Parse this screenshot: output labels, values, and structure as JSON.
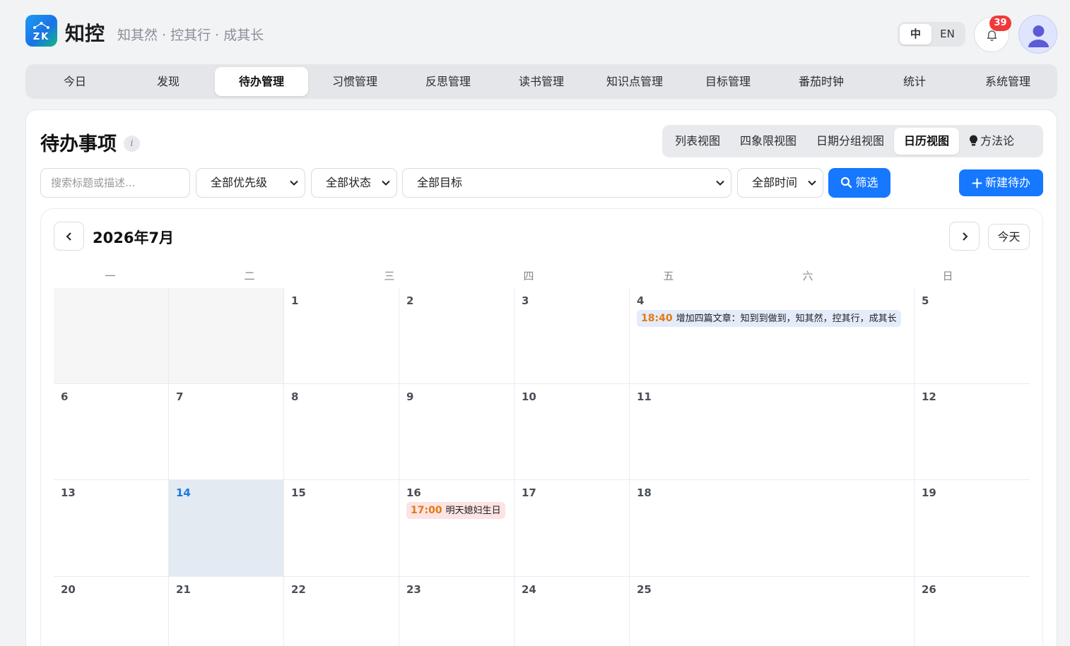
{
  "app": {
    "logo_text": "ZK",
    "name": "知控",
    "slogan": "知其然 · 控其行 · 成其长"
  },
  "lang": {
    "zh": "中",
    "en": "EN",
    "active": "zh"
  },
  "notifications": {
    "count": "39"
  },
  "nav": {
    "items": [
      "今日",
      "发现",
      "待办管理",
      "习惯管理",
      "反思管理",
      "读书管理",
      "知识点管理",
      "目标管理",
      "番茄时钟",
      "统计",
      "系统管理"
    ],
    "active": "待办管理"
  },
  "page": {
    "title": "待办事项",
    "info": "i"
  },
  "views": {
    "list": "列表视图",
    "quadrant": "四象限视图",
    "date_group": "日期分组视图",
    "calendar": "日历视图",
    "method": "方法论",
    "active": "日历视图"
  },
  "filters": {
    "search_placeholder": "搜索标题或描述...",
    "priority": "全部优先级",
    "status": "全部状态",
    "goal": "全部目标",
    "time": "全部时间",
    "filter_button": "筛选",
    "new_button": "新建待办"
  },
  "calendar": {
    "title": "2026年7月",
    "today_button": "今天",
    "weekdays": [
      "一",
      "二",
      "三",
      "四",
      "五",
      "六",
      "日"
    ],
    "weeks": [
      [
        {
          "day": "",
          "outside": true
        },
        {
          "day": "",
          "outside": true
        },
        {
          "day": "1"
        },
        {
          "day": "2"
        },
        {
          "day": "3"
        },
        {
          "day": "4",
          "events": [
            {
              "time": "18:40",
              "title": "增加四篇文章：知到到做到，知其然，控其行，成其长",
              "color": "blue"
            }
          ]
        },
        {
          "day": "5"
        }
      ],
      [
        {
          "day": "6"
        },
        {
          "day": "7"
        },
        {
          "day": "8"
        },
        {
          "day": "9"
        },
        {
          "day": "10"
        },
        {
          "day": "11"
        },
        {
          "day": "12"
        }
      ],
      [
        {
          "day": "13"
        },
        {
          "day": "14",
          "today": true
        },
        {
          "day": "15"
        },
        {
          "day": "16",
          "events": [
            {
              "time": "17:00",
              "title": "明天媳妇生日",
              "color": "pink"
            }
          ]
        },
        {
          "day": "17"
        },
        {
          "day": "18"
        },
        {
          "day": "19"
        }
      ],
      [
        {
          "day": "20"
        },
        {
          "day": "21"
        },
        {
          "day": "22"
        },
        {
          "day": "23"
        },
        {
          "day": "24"
        },
        {
          "day": "25"
        },
        {
          "day": "26"
        }
      ]
    ]
  }
}
